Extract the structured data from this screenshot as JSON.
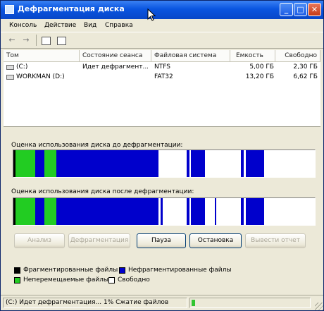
{
  "window": {
    "title": "Дефрагментация диска"
  },
  "titlebar_buttons": {
    "minimize": "_",
    "maximize": "□",
    "close": "✕"
  },
  "menu": [
    "Консоль",
    "Действие",
    "Вид",
    "Справка"
  ],
  "toolbar": {
    "back_glyph": "←",
    "forward_glyph": "→"
  },
  "volumes": {
    "headers": [
      "Том",
      "Состояние сеанса",
      "Файловая система",
      "Емкость",
      "Свободно"
    ],
    "rows": [
      {
        "name": "(C:)",
        "status": "Идет дефрагмент...",
        "fs": "NTFS",
        "capacity": "5,00 ГБ",
        "free": "2,30 ГБ"
      },
      {
        "name": "WORKMAN (D:)",
        "status": "",
        "fs": "FAT32",
        "capacity": "13,20 ГБ",
        "free": "6,62 ГБ"
      }
    ]
  },
  "analysis": {
    "before_label": "Оценка использования диска до дефрагментации:",
    "after_label": "Оценка использования диска после дефрагментации:"
  },
  "buttons": {
    "analyze": "Анализ",
    "defragment": "Дефрагментация",
    "pause": "Пауза",
    "stop": "Остановка",
    "report": "Вывести отчет"
  },
  "legend": {
    "fragmented": "Фрагментированные файлы",
    "contiguous": "Нефрагментированные файлы",
    "unmovable": "Неперемещаемые файлы",
    "free": "Свободно"
  },
  "colors": {
    "fragmented": "#000000",
    "contiguous": "#0000cc",
    "unmovable": "#22cc22",
    "free": "#ffffff"
  },
  "status": {
    "text": "(C:) Идет дефрагментация... 1% Сжатие файлов"
  }
}
